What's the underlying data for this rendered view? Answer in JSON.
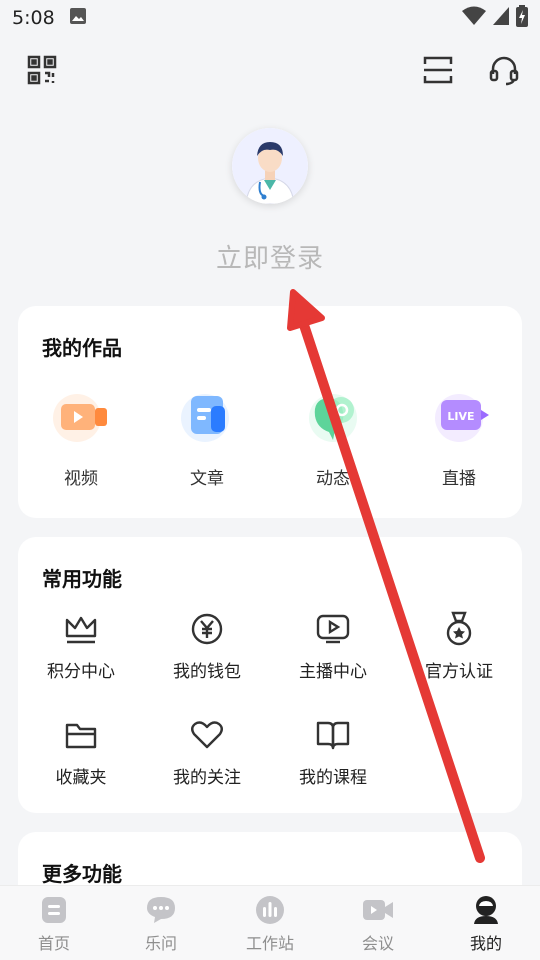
{
  "status_bar": {
    "time": "5:08"
  },
  "login": {
    "text": "立即登录"
  },
  "works": {
    "title": "我的作品",
    "items": [
      {
        "label": "视频",
        "icon": "video-icon"
      },
      {
        "label": "文章",
        "icon": "article-icon"
      },
      {
        "label": "动态",
        "icon": "moments-icon"
      },
      {
        "label": "直播",
        "icon": "live-icon",
        "badge": "LIVE"
      }
    ]
  },
  "functions": {
    "title": "常用功能",
    "items": [
      {
        "label": "积分中心",
        "icon": "crown-icon"
      },
      {
        "label": "我的钱包",
        "icon": "yen-coin-icon"
      },
      {
        "label": "主播中心",
        "icon": "play-screen-icon"
      },
      {
        "label": "官方认证",
        "icon": "medal-icon"
      },
      {
        "label": "收藏夹",
        "icon": "folder-icon"
      },
      {
        "label": "我的关注",
        "icon": "heart-icon"
      },
      {
        "label": "我的课程",
        "icon": "book-icon"
      }
    ]
  },
  "more": {
    "title": "更多功能"
  },
  "tabbar": {
    "tabs": [
      {
        "label": "首页",
        "icon": "home-icon",
        "active": false
      },
      {
        "label": "乐问",
        "icon": "chat-bubble-icon",
        "active": false
      },
      {
        "label": "工作站",
        "icon": "workstation-icon",
        "active": false
      },
      {
        "label": "会议",
        "icon": "video-camera-icon",
        "active": false
      },
      {
        "label": "我的",
        "icon": "profile-icon",
        "active": true
      }
    ]
  },
  "colors": {
    "accent_text": "#111111",
    "inactive_tab": "#8e8e8e",
    "annotation_arrow": "#e53935",
    "login_placeholder": "#b8b8b8"
  }
}
